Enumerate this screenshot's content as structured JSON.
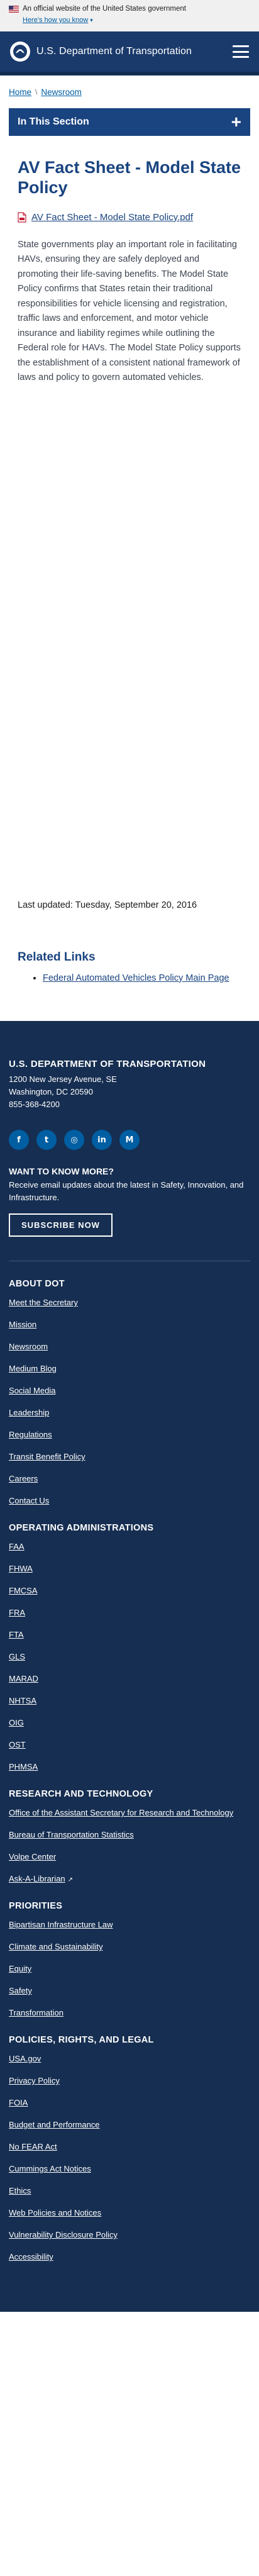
{
  "gov_banner": {
    "official_text": "An official website of the United States government",
    "how_know": "Here's how you know"
  },
  "header": {
    "logo_text": "U.S. Department of Transportation",
    "menu_icon": "hamburger-menu-icon"
  },
  "breadcrumb": {
    "home": "Home",
    "separator": "\\",
    "current": "Newsroom"
  },
  "in_this_section": {
    "label": "In This Section",
    "toggle": "+"
  },
  "main": {
    "title": "AV Fact Sheet - Model State Policy",
    "file_link": "AV Fact Sheet - Model State Policy.pdf",
    "body": "State governments play an important role in facilitating HAVs, ensuring they are safely deployed and promoting their life-saving benefits. The Model State Policy confirms that States retain their traditional responsibilities for vehicle licensing and registration, traffic laws and enforcement, and motor vehicle insurance and liability regimes while outlining the Federal role for HAVs. The Model State Policy supports the establishment of a consistent national framework of laws and policy to govern automated vehicles.",
    "last_updated": "Last updated: Tuesday, September 20, 2016"
  },
  "related": {
    "heading": "Related Links",
    "links": [
      "Federal Automated Vehicles Policy Main Page"
    ]
  },
  "footer": {
    "org": "U.S. DEPARTMENT OF TRANSPORTATION",
    "address_line1": "1200 New Jersey Avenue, SE",
    "address_line2": "Washington, DC 20590",
    "phone": "855-368-4200",
    "social": [
      {
        "icon": "facebook-icon",
        "glyph": "f"
      },
      {
        "icon": "twitter-icon",
        "glyph": "t"
      },
      {
        "icon": "instagram-icon",
        "glyph": "◎"
      },
      {
        "icon": "linkedin-icon",
        "glyph": "in"
      },
      {
        "icon": "medium-icon",
        "glyph": "M"
      }
    ],
    "want_heading": "WANT TO KNOW MORE?",
    "want_text": "Receive email updates about the latest in Safety, Innovation, and Infrastructure.",
    "subscribe": "SUBSCRIBE NOW",
    "sections": [
      {
        "heading": "ABOUT DOT",
        "links": [
          "Meet the Secretary",
          "Mission",
          "Newsroom",
          "Medium Blog",
          "Social Media",
          "Leadership",
          "Regulations",
          "Transit Benefit Policy",
          "Careers",
          "Contact Us"
        ]
      },
      {
        "heading": "OPERATING ADMINISTRATIONS",
        "links": [
          "FAA",
          "FHWA",
          "FMCSA",
          "FRA",
          "FTA",
          "GLS",
          "MARAD",
          "NHTSA",
          "OIG",
          "OST",
          "PHMSA"
        ]
      },
      {
        "heading": "RESEARCH AND TECHNOLOGY",
        "links": [
          "Office of the Assistant Secretary for Research and Technology",
          "Bureau of Transportation Statistics",
          "Volpe Center",
          "Ask-A-Librarian"
        ]
      },
      {
        "heading": "PRIORITIES",
        "links": [
          "Bipartisan Infrastructure Law",
          "Climate and Sustainability",
          "Equity",
          "Safety",
          "Transformation"
        ]
      },
      {
        "heading": "POLICIES, RIGHTS, AND LEGAL",
        "links": [
          "USA.gov",
          "Privacy Policy",
          "FOIA",
          "Budget and Performance",
          "No FEAR Act",
          "Cummings Act Notices",
          "Ethics",
          "Web Policies and Notices",
          "Vulnerability Disclosure Policy",
          "Accessibility"
        ]
      }
    ]
  },
  "colors": {
    "header_bg": "#1a3a6b",
    "primary": "#1a4480",
    "footer_bg": "#162e51",
    "link": "#005ea2"
  }
}
